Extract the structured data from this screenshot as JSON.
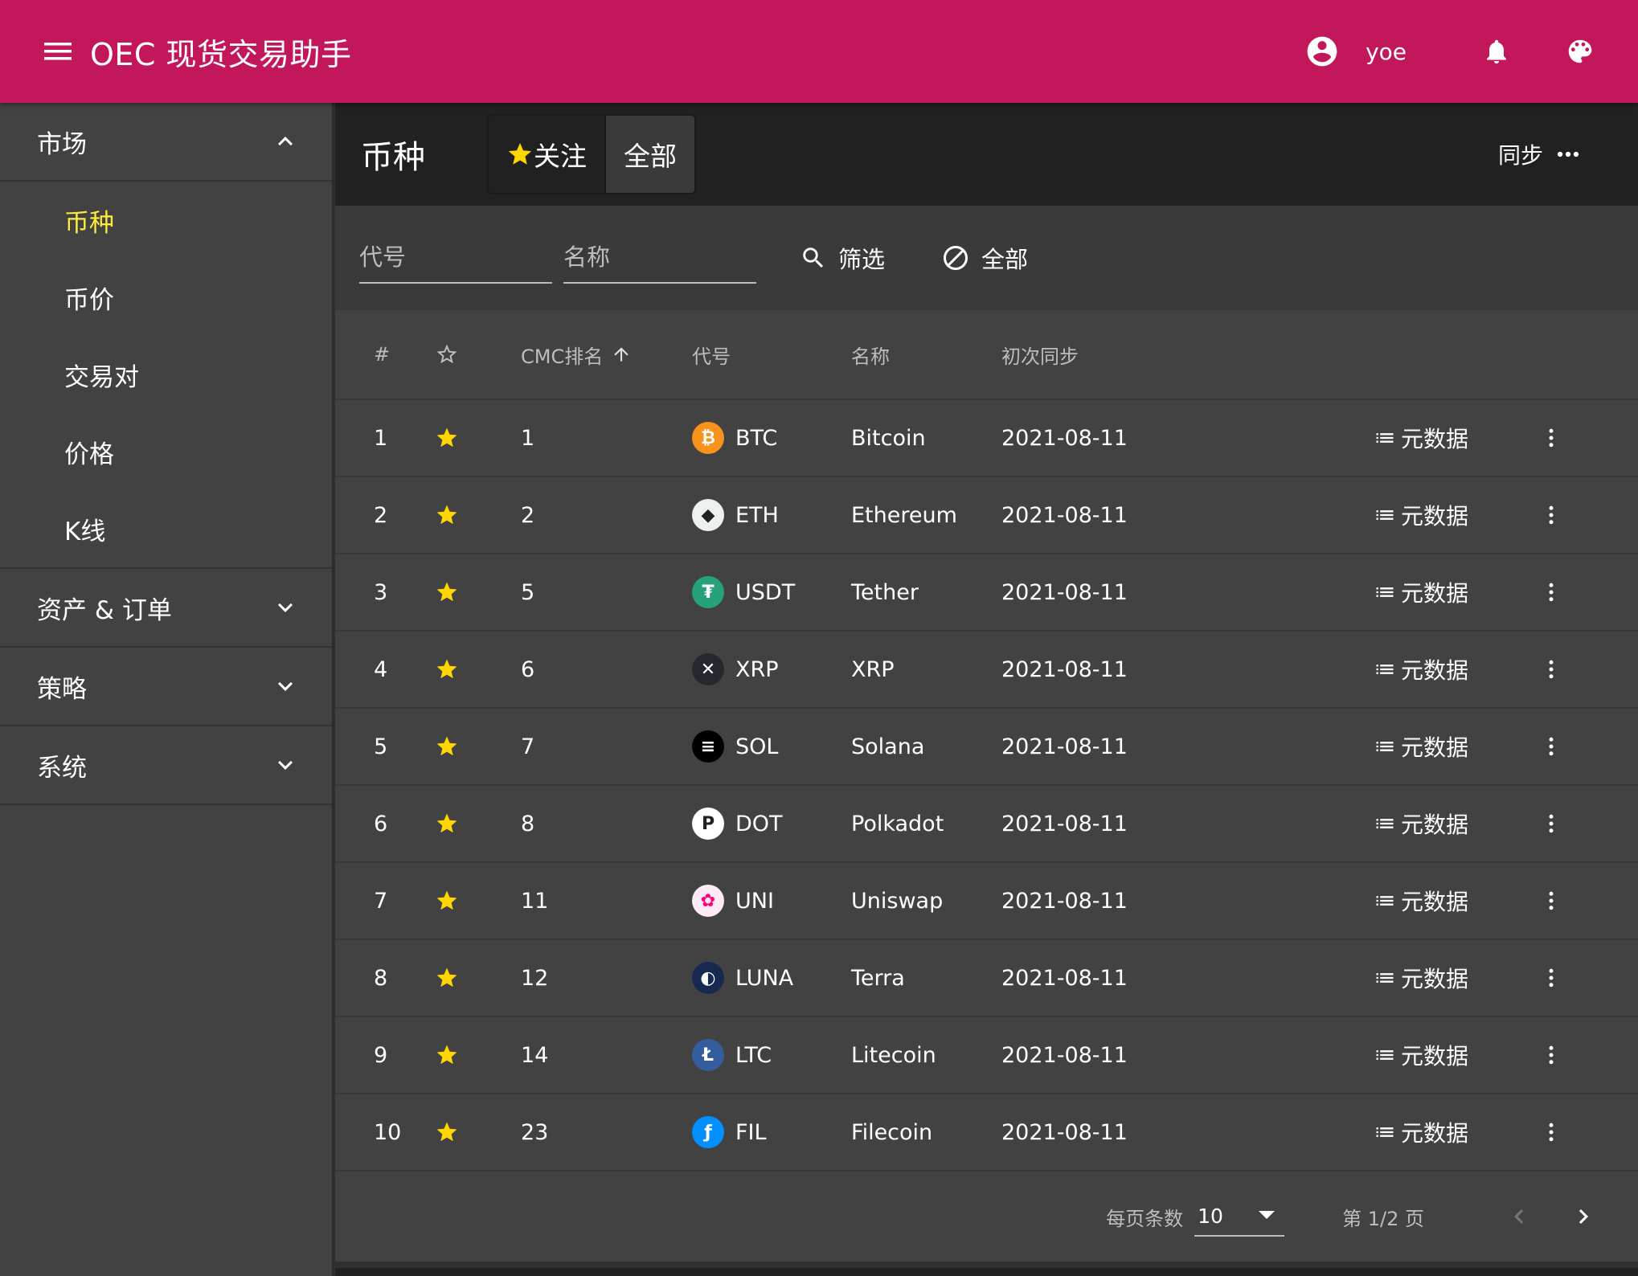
{
  "app": {
    "title": "OEC 现货交易助手",
    "username": "yoe"
  },
  "sidebar": {
    "groups": [
      {
        "label": "市场",
        "expanded": true,
        "items": [
          {
            "label": "币种",
            "active": true
          },
          {
            "label": "币价"
          },
          {
            "label": "交易对"
          },
          {
            "label": "价格"
          },
          {
            "label": "K线"
          }
        ]
      },
      {
        "label": "资产 & 订单",
        "expanded": false
      },
      {
        "label": "策略",
        "expanded": false
      },
      {
        "label": "系统",
        "expanded": false
      }
    ]
  },
  "toolbar": {
    "title": "币种",
    "fav_label": "关注",
    "all_label": "全部",
    "sync_label": "同步"
  },
  "filter": {
    "code_placeholder": "代号",
    "name_placeholder": "名称",
    "filter_label": "筛选",
    "clear_label": "全部"
  },
  "table": {
    "headers": {
      "idx": "#",
      "rank": "CMC排名",
      "code": "代号",
      "name": "名称",
      "first_sync": "初次同步"
    },
    "meta_label": "元数据",
    "rows": [
      {
        "idx": "1",
        "rank": "1",
        "code": "BTC",
        "name": "Bitcoin",
        "first_sync": "2021-08-11",
        "coin_color": "#f7931a",
        "coin_glyph": "₿",
        "coin_icon": "bitcoin-icon"
      },
      {
        "idx": "2",
        "rank": "2",
        "code": "ETH",
        "name": "Ethereum",
        "first_sync": "2021-08-11",
        "coin_color": "#ecf0f1",
        "coin_glyph": "◆",
        "coin_icon": "ethereum-icon"
      },
      {
        "idx": "3",
        "rank": "5",
        "code": "USDT",
        "name": "Tether",
        "first_sync": "2021-08-11",
        "coin_color": "#26a17b",
        "coin_glyph": "₮",
        "coin_icon": "tether-icon"
      },
      {
        "idx": "4",
        "rank": "6",
        "code": "XRP",
        "name": "XRP",
        "first_sync": "2021-08-11",
        "coin_color": "#23292f",
        "coin_glyph": "✕",
        "coin_icon": "xrp-icon"
      },
      {
        "idx": "5",
        "rank": "7",
        "code": "SOL",
        "name": "Solana",
        "first_sync": "2021-08-11",
        "coin_color": "#000000",
        "coin_glyph": "≡",
        "coin_icon": "solana-icon"
      },
      {
        "idx": "6",
        "rank": "8",
        "code": "DOT",
        "name": "Polkadot",
        "first_sync": "2021-08-11",
        "coin_color": "#ffffff",
        "coin_glyph": "P",
        "coin_icon": "polkadot-icon"
      },
      {
        "idx": "7",
        "rank": "11",
        "code": "UNI",
        "name": "Uniswap",
        "first_sync": "2021-08-11",
        "coin_color": "#ffeaf6",
        "coin_glyph": "✿",
        "coin_icon": "uniswap-icon"
      },
      {
        "idx": "8",
        "rank": "12",
        "code": "LUNA",
        "name": "Terra",
        "first_sync": "2021-08-11",
        "coin_color": "#172852",
        "coin_glyph": "◐",
        "coin_icon": "terra-icon"
      },
      {
        "idx": "9",
        "rank": "14",
        "code": "LTC",
        "name": "Litecoin",
        "first_sync": "2021-08-11",
        "coin_color": "#345d9d",
        "coin_glyph": "Ł",
        "coin_icon": "litecoin-icon"
      },
      {
        "idx": "10",
        "rank": "23",
        "code": "FIL",
        "name": "Filecoin",
        "first_sync": "2021-08-11",
        "coin_color": "#0090ff",
        "coin_glyph": "ƒ",
        "coin_icon": "filecoin-icon"
      }
    ]
  },
  "pager": {
    "per_page_label": "每页条数",
    "per_page_value": "10",
    "page_info": "第 1/2 页"
  },
  "colors": {
    "appbar": "#c2185b",
    "active_nav": "#ffeb3b",
    "star": "#ffd600"
  }
}
